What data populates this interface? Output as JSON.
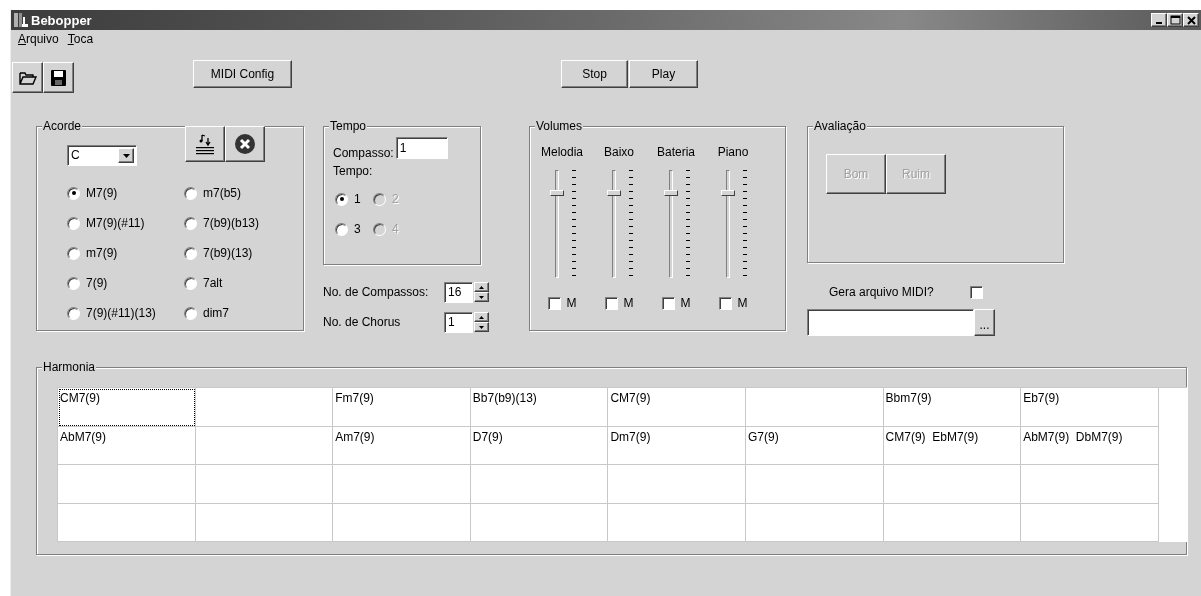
{
  "window": {
    "title": "Bebopper"
  },
  "menu": [
    {
      "label": "Arquivo"
    },
    {
      "label": "Toca"
    }
  ],
  "toolbar": {
    "midi_config": "MIDI Config",
    "stop": "Stop",
    "play": "Play"
  },
  "acorde": {
    "title": "Acorde",
    "root": "C",
    "chord_types": [
      {
        "label": "M7(9)",
        "selected": true
      },
      {
        "label": "m7(b5)",
        "selected": false
      },
      {
        "label": "M7(9)(#11)",
        "selected": false
      },
      {
        "label": "7(b9)(b13)",
        "selected": false
      },
      {
        "label": "m7(9)",
        "selected": false
      },
      {
        "label": "7(b9)(13)",
        "selected": false
      },
      {
        "label": "7(9)",
        "selected": false
      },
      {
        "label": "7alt",
        "selected": false
      },
      {
        "label": "7(9)(#11)(13)",
        "selected": false
      },
      {
        "label": "dim7",
        "selected": false
      }
    ]
  },
  "tempo": {
    "title": "Tempo",
    "compasso_label": "Compasso:",
    "compasso_value": "1",
    "tempo_label": "Tempo:",
    "beats": [
      {
        "label": "1",
        "selected": true,
        "disabled": false
      },
      {
        "label": "2",
        "selected": false,
        "disabled": true
      },
      {
        "label": "3",
        "selected": false,
        "disabled": false
      },
      {
        "label": "4",
        "selected": false,
        "disabled": true
      }
    ]
  },
  "compassos": {
    "label": "No. de Compassos:",
    "value": "16"
  },
  "chorus": {
    "label": "No. de Chorus",
    "value": "1"
  },
  "volumes": {
    "title": "Volumes",
    "channels": [
      {
        "name": "Melodia",
        "level": 0.8,
        "muted": false,
        "mute_label": "M"
      },
      {
        "name": "Baixo",
        "level": 0.8,
        "muted": false,
        "mute_label": "M"
      },
      {
        "name": "Bateria",
        "level": 0.8,
        "muted": false,
        "mute_label": "M"
      },
      {
        "name": "Piano",
        "level": 0.8,
        "muted": false,
        "mute_label": "M"
      }
    ]
  },
  "avaliacao": {
    "title": "Avaliação",
    "buttons": [
      {
        "label": "Bom",
        "disabled": true
      },
      {
        "label": "Ruim",
        "disabled": true
      }
    ]
  },
  "gera_midi": {
    "label": "Gera arquivo MIDI?",
    "checked": false,
    "browse": "..."
  },
  "harmonia": {
    "title": "Harmonia",
    "rows": [
      [
        {
          "text": "CM7(9)",
          "focused": true
        },
        {
          "focused": false
        },
        {
          "text": "Fm7(9)",
          "focused": false
        },
        {
          "text": "Bb7(b9)(13)",
          "focused": false
        },
        {
          "text": "CM7(9)",
          "focused": false
        },
        {
          "focused": false
        },
        {
          "text": "Bbm7(9)",
          "focused": false
        },
        {
          "text": "Eb7(9)",
          "focused": false
        }
      ],
      [
        {
          "text": "AbM7(9)",
          "focused": false
        },
        {
          "focused": false
        },
        {
          "text": "Am7(9)",
          "focused": false
        },
        {
          "text": "D7(9)",
          "focused": false
        },
        {
          "text": "Dm7(9)",
          "focused": false
        },
        {
          "text": "G7(9)",
          "focused": false
        },
        {
          "text": "CM7(9)  EbM7(9)",
          "focused": false
        },
        {
          "text": "AbM7(9)  DbM7(9)",
          "focused": false
        }
      ],
      [
        {
          "focused": false
        },
        {
          "focused": false
        },
        {
          "focused": false
        },
        {
          "focused": false
        },
        {
          "focused": false
        },
        {
          "focused": false
        },
        {
          "focused": false
        },
        {
          "focused": false
        }
      ],
      [
        {
          "focused": false
        },
        {
          "focused": false
        },
        {
          "focused": false
        },
        {
          "focused": false
        },
        {
          "focused": false
        },
        {
          "focused": false
        },
        {
          "focused": false
        },
        {
          "focused": false
        }
      ]
    ]
  }
}
